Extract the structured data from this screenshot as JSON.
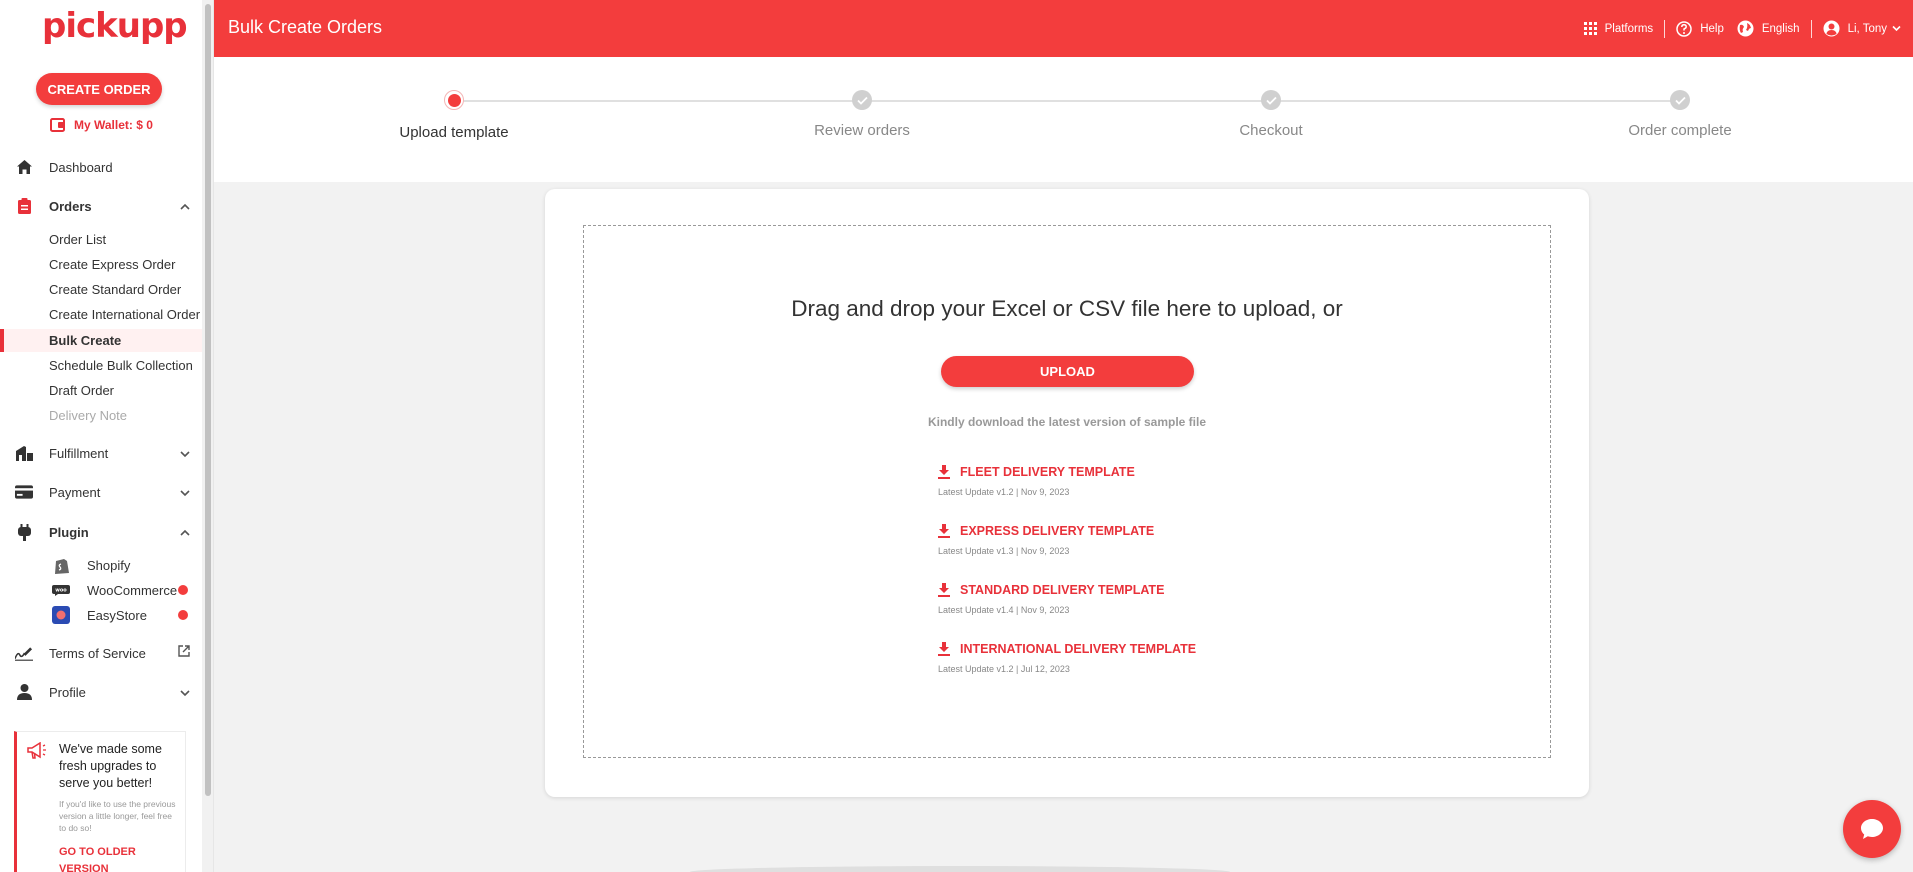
{
  "brand": {
    "logo_text": "pickupp",
    "accent": "#f33d3d"
  },
  "sidebar": {
    "create_order": "CREATE ORDER",
    "wallet": "My Wallet: $ 0",
    "dashboard": "Dashboard",
    "orders": {
      "label": "Orders",
      "items": [
        "Order List",
        "Create Express Order",
        "Create Standard Order",
        "Create International Order",
        "Bulk Create",
        "Schedule Bulk Collection",
        "Draft Order",
        "Delivery Note"
      ]
    },
    "fulfillment": "Fulfillment",
    "payment": "Payment",
    "plugin": {
      "label": "Plugin",
      "items": [
        "Shopify",
        "WooCommerce",
        "EasyStore"
      ]
    },
    "terms": "Terms of Service",
    "profile": "Profile",
    "notice": {
      "title": "We've made some fresh upgrades to serve you better!",
      "body": "If you'd like to use the previous version a little longer, feel free to do so!",
      "link": "GO TO OLDER VERSION"
    }
  },
  "header": {
    "title": "Bulk Create Orders",
    "platforms": "Platforms",
    "help": "Help",
    "language": "English",
    "user": "Li, Tony"
  },
  "stepper": {
    "steps": [
      "Upload template",
      "Review orders",
      "Checkout",
      "Order complete"
    ],
    "current": 0
  },
  "upload": {
    "drop_text": "Drag and drop your Excel or CSV file here to upload, or",
    "button": "UPLOAD",
    "hint": "Kindly download the latest version of sample file",
    "templates": [
      {
        "name": "FLEET DELIVERY TEMPLATE",
        "meta": "Latest Update v1.2 | Nov 9, 2023"
      },
      {
        "name": "EXPRESS DELIVERY TEMPLATE",
        "meta": "Latest Update v1.3 | Nov 9, 2023"
      },
      {
        "name": "STANDARD DELIVERY TEMPLATE",
        "meta": "Latest Update v1.4 | Nov 9, 2023"
      },
      {
        "name": "INTERNATIONAL DELIVERY TEMPLATE",
        "meta": "Latest Update v1.2 | Jul 12, 2023"
      }
    ]
  }
}
